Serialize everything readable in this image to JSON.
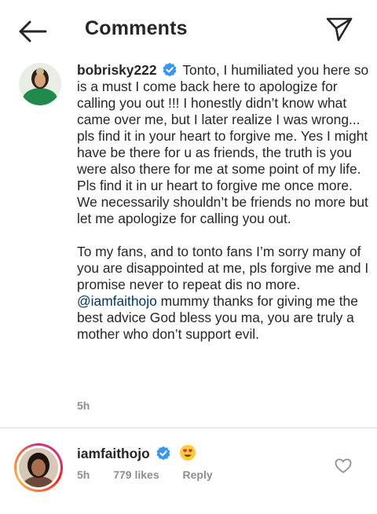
{
  "header": {
    "title": "Comments",
    "back_icon": "arrow-left-icon",
    "share_icon": "paper-plane-icon"
  },
  "caption": {
    "username": "bobrisky222",
    "verified_color": "#3897f0",
    "paragraphs": [
      "Tonto, I humiliated you here so is a must I come back here to apologize for calling you out !!! I honestly didn’t know what came over me, but I later realize I was wrong... pls find it in your heart to forgive me. Yes I might have be there for u as friends, the truth is you were also there for me at some point of my life. Pls find it in ur heart to forgive me once more. We necessarily shouldn’t be friends no more but let me apologize for calling you out.",
      "To my fans, and to tonto fans I’m sorry many of you are disappointed at me, pls forgive me and I promise never to repeat dis no more."
    ],
    "mention": "@iamfaithojo",
    "mention_text": " mummy thanks for giving me the best advice God bless you ma, you are truly a mother who don’t support evil.",
    "time": "5h"
  },
  "comment": {
    "username": "iamfaithojo",
    "emoji": "heart-eyes-emoji",
    "time": "5h",
    "likes": "779 likes",
    "reply_label": "Reply",
    "like_icon": "heart-outline-icon"
  },
  "colors": {
    "text": "#262626",
    "muted": "#8e8e8e",
    "link": "#00376b",
    "verified": "#3897f0"
  }
}
